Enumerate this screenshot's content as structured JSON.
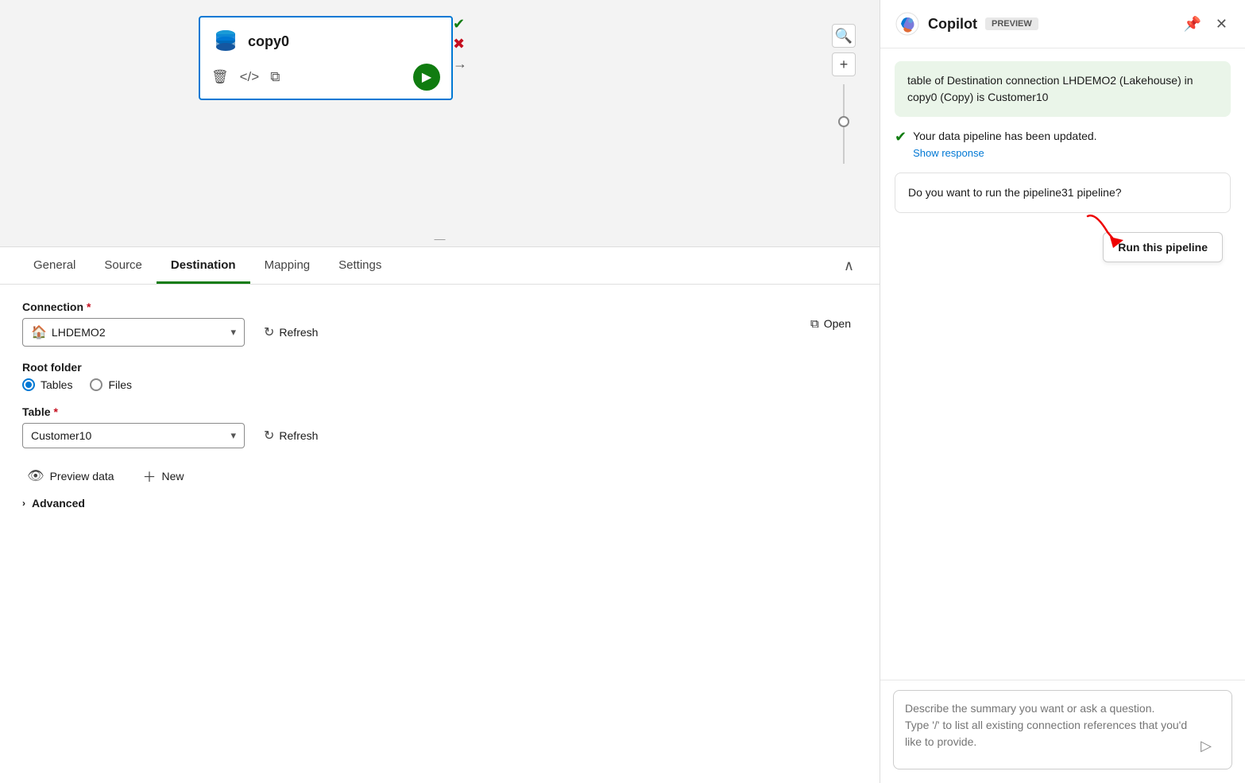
{
  "canvas": {
    "node": {
      "title": "copy0",
      "icon_alt": "copy activity icon"
    }
  },
  "tabs": {
    "items": [
      {
        "label": "General",
        "active": false
      },
      {
        "label": "Source",
        "active": false
      },
      {
        "label": "Destination",
        "active": true
      },
      {
        "label": "Mapping",
        "active": false
      },
      {
        "label": "Settings",
        "active": false
      }
    ]
  },
  "config": {
    "connection_label": "Connection",
    "connection_value": "LHDEMO2",
    "open_label": "Open",
    "refresh_label": "Refresh",
    "root_folder_label": "Root folder",
    "radio_tables": "Tables",
    "radio_files": "Files",
    "table_label": "Table",
    "table_value": "Customer10",
    "preview_data_label": "Preview data",
    "new_label": "New",
    "advanced_label": "Advanced"
  },
  "copilot": {
    "title": "Copilot",
    "preview_badge": "PREVIEW",
    "msg_bubble": "table of Destination connection LHDEMO2 (Lakehouse) in copy0 (Copy) is Customer10",
    "update_notice": "Your data pipeline has been updated.",
    "show_response": "Show response",
    "question_msg": "Do you want to run the pipeline31 pipeline?",
    "run_btn_label": "Run this pipeline",
    "input_placeholder": "Describe the summary you want or ask a question.\nType '/' to list all existing connection references that you'd like to provide."
  }
}
